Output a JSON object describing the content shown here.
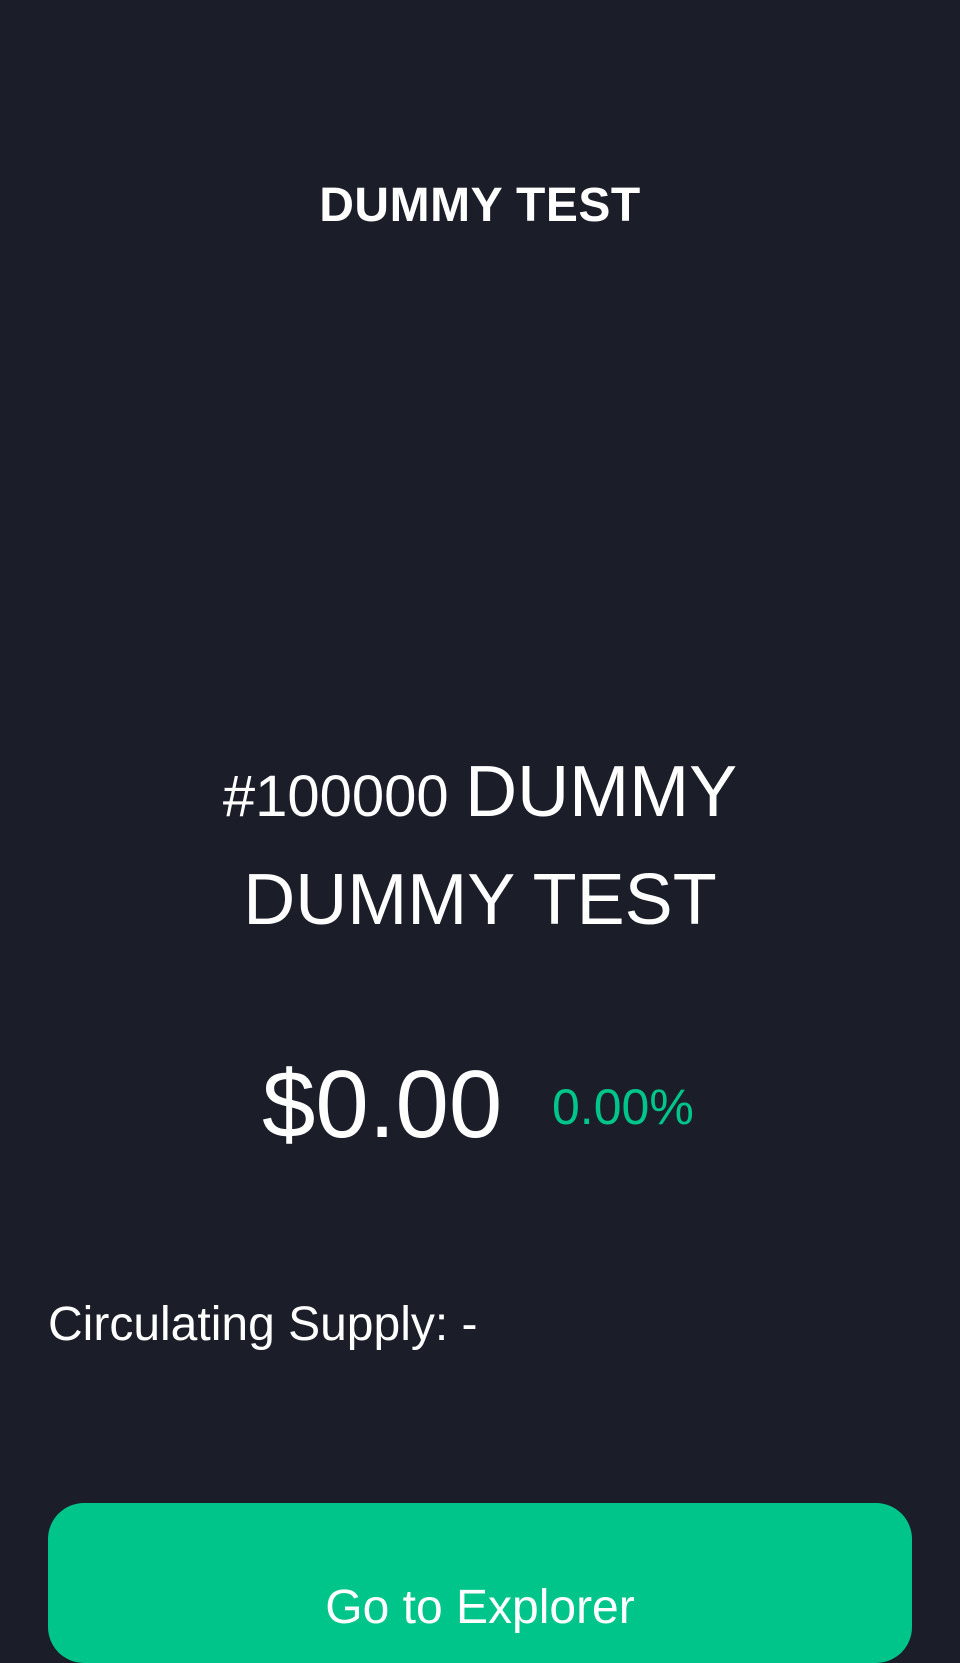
{
  "header": {
    "title": "DUMMY TEST"
  },
  "coin": {
    "rank": "#100000",
    "name": "DUMMY DUMMY TEST"
  },
  "price": {
    "value": "$0.00",
    "change": "0.00%"
  },
  "supply": {
    "text": "Circulating Supply: -"
  },
  "actions": {
    "explorer_label": "Go to Explorer"
  },
  "colors": {
    "background": "#1b1e29",
    "accent": "#00c58a",
    "text": "#ffffff"
  }
}
